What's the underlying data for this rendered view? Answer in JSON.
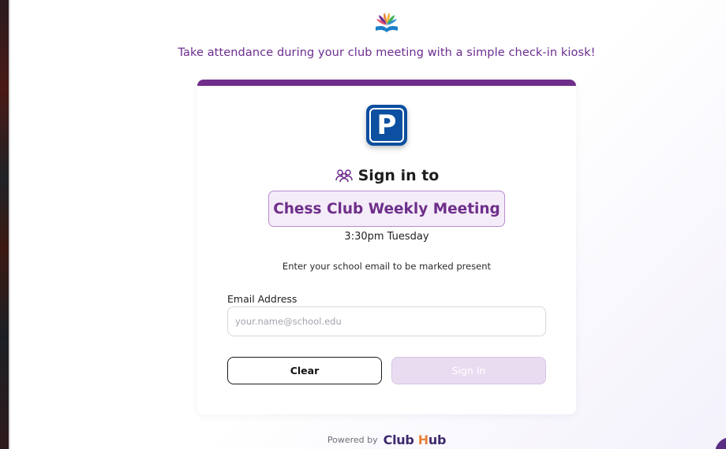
{
  "header": {
    "logo_icon": "books-flower-icon",
    "tagline": "Take attendance during your club meeting with a simple check-in kiosk!"
  },
  "card": {
    "accent_color": "#6e2e8a",
    "club_icon": "parking-sign-icon",
    "club_icon_letter": "P",
    "signin_icon": "people-group-icon",
    "signin_title": "Sign in to",
    "meeting_name": "Chess Club Weekly Meeting",
    "meeting_time": "3:30pm Tuesday",
    "instructions": "Enter your school email to be marked present",
    "email": {
      "label": "Email Address",
      "placeholder": "your.name@school.edu",
      "value": ""
    },
    "buttons": {
      "clear_label": "Clear",
      "signin_label": "Sign In",
      "signin_disabled": true
    }
  },
  "footer": {
    "powered_by": "Powered by",
    "brand_club": "Club",
    "brand_h": "H",
    "brand_ub": "ub"
  },
  "colors": {
    "primary": "#6e2e8a",
    "pill_bg": "#f4ecf8",
    "disabled_button": "#e9dcf0",
    "brand_orange": "#e8833a"
  }
}
